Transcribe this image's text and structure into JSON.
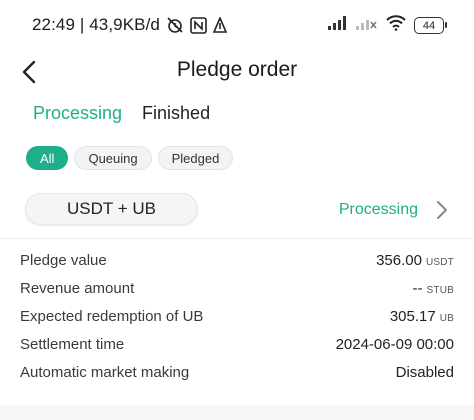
{
  "status_bar": {
    "time_speed": "22:49 | 43,9KB/d",
    "battery": "44",
    "icons": [
      "alarm-off-icon",
      "nfc-icon",
      "data-arrow-icon",
      "signal-icon",
      "signal-no-sim-icon",
      "wifi-icon",
      "battery-icon"
    ]
  },
  "header": {
    "back_icon": "chevron-left-icon",
    "title": "Pledge order"
  },
  "tabs": [
    {
      "label": "Processing",
      "active": true
    },
    {
      "label": "Finished",
      "active": false
    }
  ],
  "filters": [
    {
      "label": "All",
      "active": true
    },
    {
      "label": "Queuing",
      "active": false
    },
    {
      "label": "Pledged",
      "active": false
    }
  ],
  "order": {
    "pair": "USDT + UB",
    "status": "Processing",
    "details": [
      {
        "label": "Pledge value",
        "value": "356.00",
        "unit": "USDT"
      },
      {
        "label": "Revenue amount",
        "value": "--",
        "unit": "STUB"
      },
      {
        "label": "Expected redemption of UB",
        "value": "305.17",
        "unit": "UB"
      },
      {
        "label": "Settlement time",
        "value": "2024-06-09 00:00",
        "unit": ""
      },
      {
        "label": "Automatic market making",
        "value": "Disabled",
        "unit": ""
      }
    ]
  },
  "colors": {
    "accent": "#1fae8c",
    "chip_bg": "#f1f3f5",
    "text": "#222222"
  }
}
